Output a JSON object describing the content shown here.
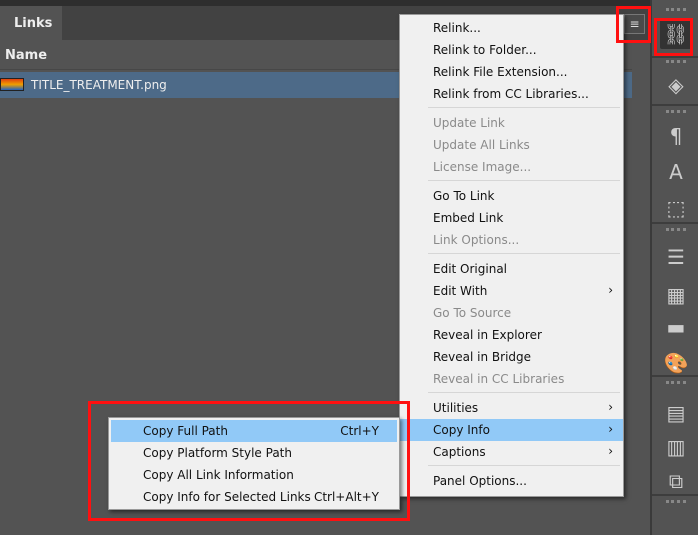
{
  "panel": {
    "tab": "Links",
    "column_name": "Name",
    "rows": [
      {
        "name": "TITLE_TREATMENT.png",
        "selected": true
      }
    ]
  },
  "menu": {
    "items": [
      {
        "label": "Relink...",
        "disabled": false
      },
      {
        "label": "Relink to Folder...",
        "disabled": false
      },
      {
        "label": "Relink File Extension...",
        "disabled": false
      },
      {
        "label": "Relink from CC Libraries...",
        "disabled": false
      },
      {
        "sep": true
      },
      {
        "label": "Update Link",
        "disabled": true
      },
      {
        "label": "Update All Links",
        "disabled": true
      },
      {
        "label": "License Image...",
        "disabled": true
      },
      {
        "sep": true
      },
      {
        "label": "Go To Link",
        "disabled": false
      },
      {
        "label": "Embed Link",
        "disabled": false
      },
      {
        "label": "Link Options...",
        "disabled": true
      },
      {
        "sep": true
      },
      {
        "label": "Edit Original",
        "disabled": false
      },
      {
        "label": "Edit With",
        "disabled": false,
        "submenu": true
      },
      {
        "label": "Go To Source",
        "disabled": true
      },
      {
        "label": "Reveal in Explorer",
        "disabled": false
      },
      {
        "label": "Reveal in Bridge",
        "disabled": false
      },
      {
        "label": "Reveal in CC Libraries",
        "disabled": true
      },
      {
        "sep": true
      },
      {
        "label": "Utilities",
        "disabled": false,
        "submenu": true
      },
      {
        "label": "Copy Info",
        "disabled": false,
        "submenu": true,
        "highlighted": true
      },
      {
        "label": "Captions",
        "disabled": false,
        "submenu": true
      },
      {
        "sep": true
      },
      {
        "label": "Panel Options...",
        "disabled": false
      }
    ]
  },
  "submenu": {
    "items": [
      {
        "label": "Copy Full Path",
        "shortcut": "Ctrl+Y",
        "highlighted": true
      },
      {
        "label": "Copy Platform Style Path",
        "shortcut": ""
      },
      {
        "label": "Copy All Link Information",
        "shortcut": ""
      },
      {
        "label": "Copy Info for Selected Links",
        "shortcut": "Ctrl+Alt+Y"
      }
    ]
  },
  "dock": {
    "icons": [
      "links-icon",
      "layers-icon",
      "paragraph-styles-icon",
      "character-styles-icon",
      "object-styles-icon",
      "stroke-icon",
      "swatches-grid-icon",
      "gradient-icon",
      "color-palette-icon",
      "table-icon",
      "table-styles-icon",
      "cell-styles-icon"
    ]
  },
  "colors": {
    "highlight": "#91c9f7",
    "selected_row": "#4d6a88",
    "annotation": "#ff1010"
  }
}
